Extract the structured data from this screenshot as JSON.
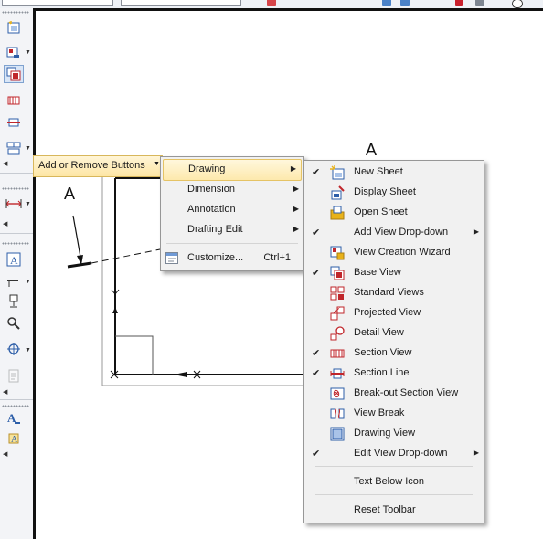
{
  "drawing": {
    "view_label_top": "A",
    "view_label_left": "A"
  },
  "add_remove_bar": {
    "label": "Add or Remove Buttons",
    "caret_icon": "caret-down-icon"
  },
  "submenu": {
    "items": [
      {
        "label": "Drawing",
        "has_submenu": true,
        "highlighted": true
      },
      {
        "label": "Dimension",
        "has_submenu": true
      },
      {
        "label": "Annotation",
        "has_submenu": true
      },
      {
        "label": "Drafting Edit",
        "has_submenu": true
      },
      {
        "label": "Customize...",
        "shortcut": "Ctrl+1",
        "icon": "customize-icon"
      }
    ]
  },
  "drawing_menu": {
    "items": [
      {
        "label": "New Sheet",
        "checked": true,
        "icon": "new-sheet-icon"
      },
      {
        "label": "Display Sheet",
        "checked": false,
        "icon": "display-sheet-icon"
      },
      {
        "label": "Open Sheet",
        "checked": false,
        "icon": "open-sheet-icon"
      },
      {
        "label": "Add View Drop-down",
        "checked": true,
        "has_submenu": true
      },
      {
        "label": "View Creation Wizard",
        "checked": false,
        "icon": "view-creation-wizard-icon"
      },
      {
        "label": "Base View",
        "checked": true,
        "icon": "base-view-icon"
      },
      {
        "label": "Standard Views",
        "checked": false,
        "icon": "standard-views-icon"
      },
      {
        "label": "Projected View",
        "checked": false,
        "icon": "projected-view-icon"
      },
      {
        "label": "Detail View",
        "checked": false,
        "icon": "detail-view-icon"
      },
      {
        "label": "Section View",
        "checked": true,
        "icon": "section-view-icon"
      },
      {
        "label": "Section Line",
        "checked": true,
        "icon": "section-line-icon"
      },
      {
        "label": "Break-out Section View",
        "checked": false,
        "icon": "breakout-section-view-icon"
      },
      {
        "label": "View Break",
        "checked": false,
        "icon": "view-break-icon"
      },
      {
        "label": "Drawing View",
        "checked": false,
        "icon": "drawing-view-icon"
      },
      {
        "label": "Edit View Drop-down",
        "checked": true,
        "has_submenu": true
      }
    ],
    "text_below_icon": "Text Below Icon",
    "reset_toolbar": "Reset Toolbar",
    "check_mark": "✔",
    "submenu_arrow": "▶"
  },
  "colors": {
    "menu_bg": "#f1f1f1",
    "highlight_top": "#fff7dc",
    "highlight_bottom": "#fde9ad",
    "highlight_border": "#e5c365",
    "icon_red": "#c0262b",
    "icon_blue": "#2d5ea8",
    "icon_yellow": "#e8b21a"
  }
}
